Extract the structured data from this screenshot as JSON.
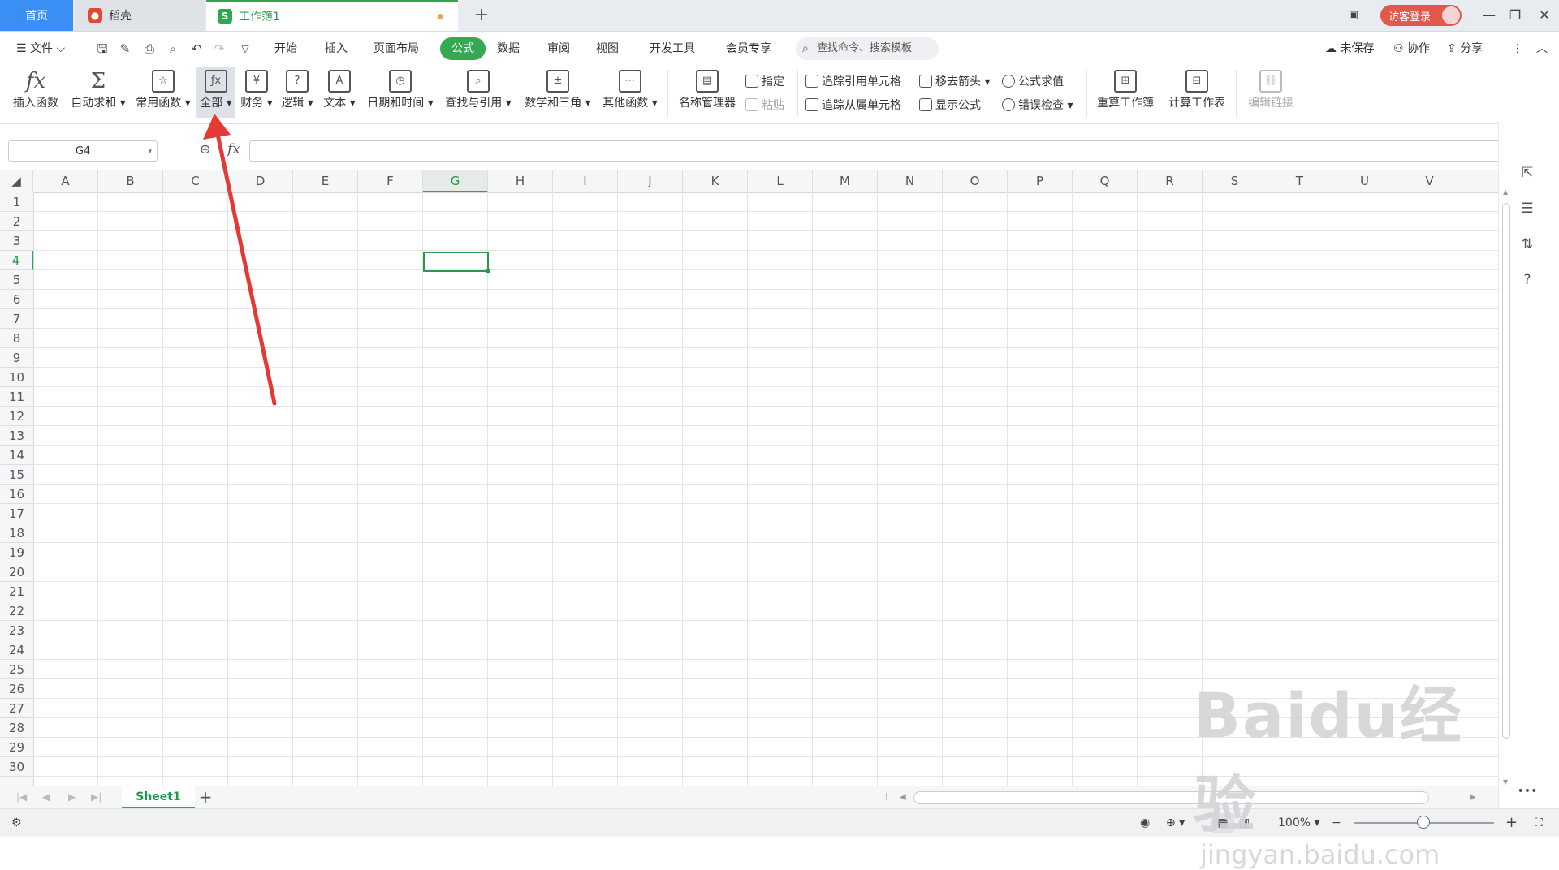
{
  "tabs": {
    "home": "首页",
    "daoke": "稻壳",
    "workbook": "工作簿1"
  },
  "titlebar": {
    "login": "访客登录"
  },
  "menu": {
    "file": "文件",
    "items": [
      "开始",
      "插入",
      "页面布局",
      "公式",
      "数据",
      "审阅",
      "视图",
      "开发工具",
      "会员专享"
    ],
    "active": "公式",
    "search_placeholder": "查找命令、搜索模板",
    "unsaved": "未保存",
    "collab": "协作",
    "share": "分享"
  },
  "ribbon": {
    "insert_func": "插入函数",
    "autosum": "自动求和",
    "common_func": "常用函数",
    "all": "全部",
    "finance": "财务",
    "logic": "逻辑",
    "text": "文本",
    "datetime": "日期和时间",
    "lookup": "查找与引用",
    "math": "数学和三角",
    "other": "其他函数",
    "name_manager": "名称管理器",
    "assign": "指定",
    "paste": "粘贴",
    "trace_precedents": "追踪引用单元格",
    "trace_dependents": "追踪从属单元格",
    "remove_arrows": "移去箭头",
    "show_formulas": "显示公式",
    "evaluate": "公式求值",
    "error_check": "错误检查",
    "recalc_book": "重算工作簿",
    "calc_sheet": "计算工作表",
    "edit_links": "编辑链接"
  },
  "formula_bar": {
    "name_box": "G4",
    "fx": "fx",
    "value": ""
  },
  "grid": {
    "columns": [
      "A",
      "B",
      "C",
      "D",
      "E",
      "F",
      "G",
      "H",
      "I",
      "J",
      "K",
      "L",
      "M",
      "N",
      "O",
      "P",
      "Q",
      "R",
      "S",
      "T",
      "U",
      "V"
    ],
    "rows": [
      "1",
      "2",
      "3",
      "4",
      "5",
      "6",
      "7",
      "8",
      "9",
      "10",
      "11",
      "12",
      "13",
      "14",
      "15",
      "16",
      "17",
      "18",
      "19",
      "20",
      "21",
      "22",
      "23",
      "24",
      "25",
      "26",
      "27",
      "28",
      "29",
      "30"
    ],
    "active_column": "G",
    "active_row": "4"
  },
  "sheets": {
    "tabs": [
      "Sheet1"
    ],
    "active": "Sheet1"
  },
  "status": {
    "zoom": "100%"
  },
  "watermark": {
    "brand": "Baidu经验",
    "url": "jingyan.baidu.com"
  },
  "colors": {
    "accent": "#34a853",
    "arrow": "#e53935",
    "login": "#e0594b"
  }
}
